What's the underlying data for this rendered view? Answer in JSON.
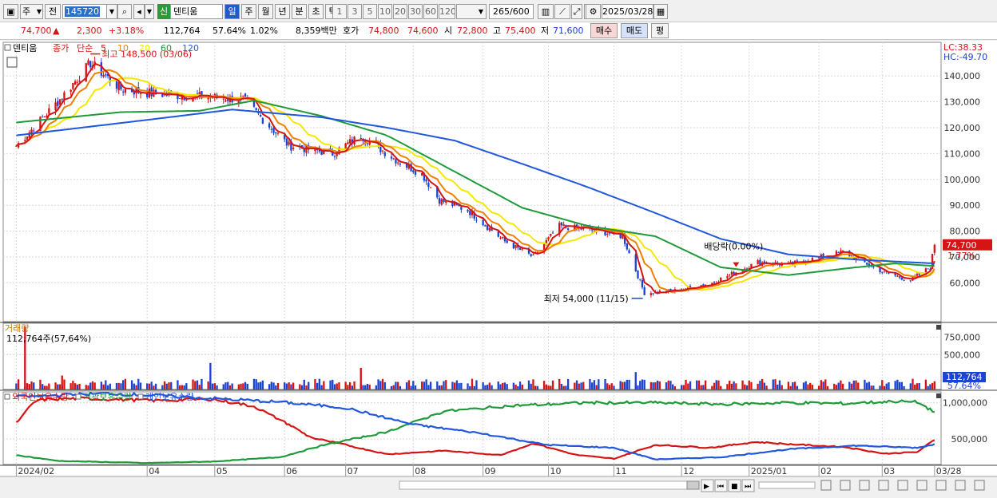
{
  "toolbar": {
    "mode_label": "주",
    "prev_label": "전",
    "code_value": "145720",
    "stock_badge": "신",
    "stock_name": "덴티움",
    "periods": [
      "일",
      "주",
      "월",
      "년",
      "분",
      "초",
      "틱"
    ],
    "period_active": "일",
    "intervals": [
      "1",
      "3",
      "5",
      "10",
      "20",
      "30",
      "60",
      "120"
    ],
    "count_display": "265",
    "count_max": "/600",
    "date_value": "2025/03/28"
  },
  "quote": {
    "price": "74,700",
    "change_arrow": "▲",
    "change": "2,300",
    "change_pct": "+3.18%",
    "volume": "112,764",
    "volume_ratio": "57.64%",
    "turnover_pct": "1.02%",
    "amount": "8,359백만",
    "ask_label": "호가",
    "ask": "74,800",
    "bid": "74,600",
    "open_label": "시",
    "open": "72,800",
    "high_label": "고",
    "high": "75,400",
    "low_label": "저",
    "low": "71,600",
    "buy_label": "매수",
    "sell_label": "매도",
    "eval_label": "평"
  },
  "colors": {
    "up": "#d51414",
    "down": "#1c44d2",
    "ma5": "#d51414",
    "ma10": "#f08000",
    "ma20": "#f5e800",
    "ma60": "#1f9a3a",
    "ma120": "#2157dc",
    "foreign": "#d51414",
    "institution": "#1f9a3a",
    "individual": "#2157dc"
  },
  "chart_data": [
    {
      "type": "candlestick",
      "legend": {
        "name": "덴티움",
        "prefix": "종가",
        "method": "단순",
        "periods": [
          "5",
          "10",
          "20",
          "60",
          "120"
        ]
      },
      "ylim": [
        45000,
        153000
      ],
      "yticks": [
        60000,
        70000,
        80000,
        90000,
        100000,
        110000,
        120000,
        130000,
        140000
      ],
      "ytick_labels": [
        "60,000",
        "70,000",
        "80,000",
        "90,000",
        "100,000",
        "110,000",
        "120,000",
        "130,000",
        "140,000"
      ],
      "x_ticks": [
        "2024/02",
        "04",
        "05",
        "06",
        "07",
        "08",
        "09",
        "10",
        "11",
        "12",
        "2025/01",
        "02",
        "03",
        "03/28"
      ],
      "x_tick_dates": [
        "2024-02-01",
        "2024-04-01",
        "2024-05-02",
        "2024-06-03",
        "2024-07-01",
        "2024-08-01",
        "2024-09-02",
        "2024-10-02",
        "2024-11-01",
        "2024-12-02",
        "2025-01-02",
        "2025-02-03",
        "2025-03-04",
        "2025-03-28"
      ],
      "lc_label": "LC:38.33",
      "hc_label": "HC:-49.70",
      "current_price_label": "74,700",
      "current_change_label": "1.77%",
      "current_price": 74700,
      "annotations": [
        {
          "text": "최고 148,500 (03/06)",
          "date": "2024-03-06",
          "value": 148500
        },
        {
          "text": "최저 54,000 (11/15)",
          "date": "2024-11-15",
          "value": 54000
        },
        {
          "text": "배당락(0.00%)",
          "date": "2024-12-27",
          "value": 63000
        }
      ],
      "anchor_dates": [
        "2024-02-01",
        "2024-02-20",
        "2024-03-06",
        "2024-03-20",
        "2024-04-05",
        "2024-04-25",
        "2024-05-15",
        "2024-06-05",
        "2024-06-25",
        "2024-07-08",
        "2024-07-25",
        "2024-08-05",
        "2024-08-13",
        "2024-08-26",
        "2024-09-12",
        "2024-09-25",
        "2024-10-07",
        "2024-10-25",
        "2024-11-05",
        "2024-11-15",
        "2024-11-29",
        "2024-12-16",
        "2025-01-06",
        "2025-01-20",
        "2025-02-14",
        "2025-03-05",
        "2025-03-17",
        "2025-03-26",
        "2025-03-28"
      ],
      "anchor_close": [
        113000,
        130000,
        145000,
        135000,
        133000,
        132000,
        131000,
        113000,
        110000,
        117000,
        107000,
        102000,
        92000,
        88000,
        76000,
        70000,
        82000,
        80000,
        78000,
        56000,
        57000,
        60000,
        68000,
        67000,
        72000,
        64000,
        61000,
        66000,
        74700
      ],
      "ma60_anchor_dates": [
        "2024-02-01",
        "2024-03-20",
        "2024-04-25",
        "2024-05-20",
        "2024-06-20",
        "2024-07-20",
        "2024-08-20",
        "2024-09-20",
        "2024-10-20",
        "2024-11-20",
        "2024-12-20",
        "2025-01-20",
        "2025-02-20",
        "2025-03-10",
        "2025-03-28"
      ],
      "ma60_values": [
        122000,
        126000,
        126500,
        130500,
        124500,
        117000,
        103000,
        89000,
        82000,
        78000,
        66000,
        63000,
        66000,
        67500,
        66500
      ],
      "ma120_anchor_dates": [
        "2024-02-01",
        "2024-04-01",
        "2024-05-10",
        "2024-06-20",
        "2024-07-20",
        "2024-08-20",
        "2024-09-20",
        "2024-10-20",
        "2024-11-20",
        "2024-12-20",
        "2025-01-20",
        "2025-02-20",
        "2025-03-28"
      ],
      "ma120_values": [
        117000,
        123000,
        127000,
        124000,
        120000,
        115000,
        106000,
        97000,
        87000,
        77000,
        71000,
        69000,
        67500
      ]
    },
    {
      "type": "bar",
      "title": "거래량",
      "info_label": "112,764주(57,64%)",
      "ylim": [
        0,
        950000
      ],
      "yticks": [
        500000,
        750000
      ],
      "ytick_labels": [
        "500,000",
        "750,000"
      ],
      "current_value_label": "112,764",
      "current_ratio_label": "57.64%",
      "current_value": 112764,
      "spike_dates": [
        "2024-02-05",
        "2024-04-30",
        "2024-07-08",
        "2024-11-11",
        "2024-02-22"
      ],
      "spike_values": [
        900000,
        380000,
        310000,
        250000,
        200000
      ]
    },
    {
      "type": "line",
      "legend": [
        "외국인보유수량",
        "기관보유수량",
        "개인보유수량"
      ],
      "ylim": [
        150000,
        1150000
      ],
      "yticks": [
        500000,
        1000000
      ],
      "ytick_labels": [
        "500,000",
        "1,000,000"
      ],
      "series": [
        {
          "name": "외국인보유수량",
          "dates": [
            "2024-02-01",
            "2024-02-10",
            "2024-03-01",
            "2024-04-05",
            "2024-05-01",
            "2024-05-20",
            "2024-06-05",
            "2024-06-15",
            "2024-07-01",
            "2024-07-20",
            "2024-08-15",
            "2024-09-10",
            "2024-09-25",
            "2024-10-15",
            "2024-11-01",
            "2024-11-20",
            "2024-12-15",
            "2025-01-05",
            "2025-01-20",
            "2025-02-15",
            "2025-03-05",
            "2025-03-20",
            "2025-03-28"
          ],
          "values": [
            720000,
            1040000,
            1060000,
            1030000,
            1050000,
            950000,
            700000,
            520000,
            420000,
            290000,
            340000,
            280000,
            440000,
            280000,
            230000,
            420000,
            380000,
            460000,
            430000,
            390000,
            300000,
            320000,
            490000
          ]
        },
        {
          "name": "기관보유수량",
          "dates": [
            "2024-02-01",
            "2024-02-20",
            "2024-04-01",
            "2024-05-01",
            "2024-06-01",
            "2024-06-20",
            "2024-07-20",
            "2024-08-15",
            "2024-09-15",
            "2024-10-20",
            "2024-11-20",
            "2024-12-20",
            "2025-01-20",
            "2025-02-15",
            "2025-03-10",
            "2025-03-20",
            "2025-03-28"
          ],
          "values": [
            280000,
            200000,
            170000,
            190000,
            250000,
            410000,
            600000,
            880000,
            960000,
            1000000,
            1000000,
            980000,
            1000000,
            990000,
            1020000,
            1010000,
            870000
          ]
        },
        {
          "name": "개인보유수량",
          "dates": [
            "2024-02-01",
            "2024-03-15",
            "2024-05-01",
            "2024-06-01",
            "2024-07-01",
            "2024-08-01",
            "2024-09-01",
            "2024-10-01",
            "2024-11-01",
            "2024-11-20",
            "2024-12-20",
            "2025-01-20",
            "2025-02-20",
            "2025-03-20",
            "2025-03-28"
          ],
          "values": [
            1080000,
            1130000,
            1060000,
            1010000,
            930000,
            700000,
            580000,
            420000,
            380000,
            220000,
            250000,
            360000,
            410000,
            380000,
            430000
          ]
        }
      ]
    }
  ]
}
